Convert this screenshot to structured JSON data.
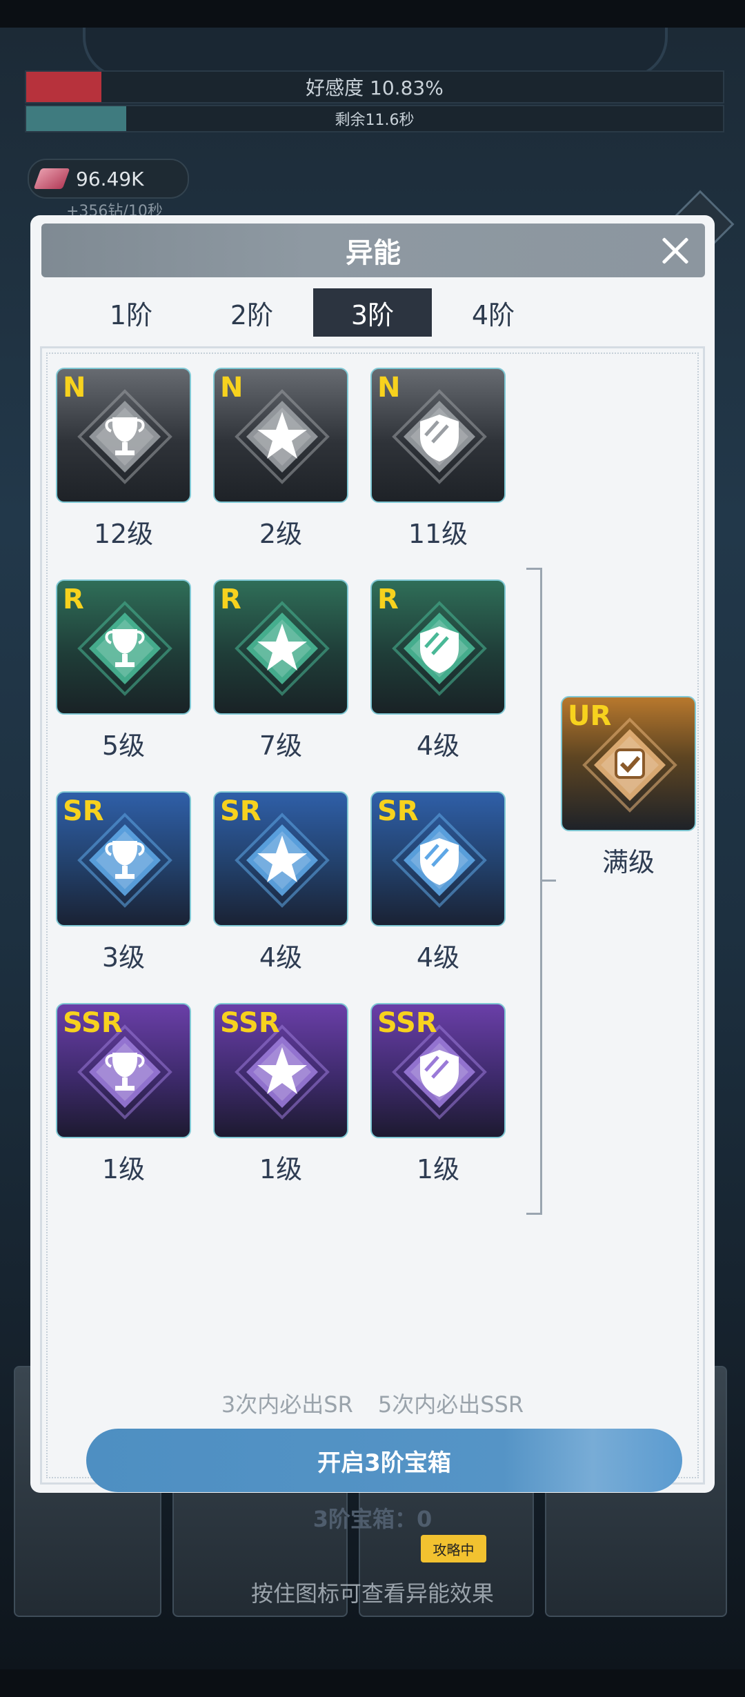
{
  "hud": {
    "affection": "好感度 10.83%",
    "affection_percent": 10.83,
    "remaining": "剩余11.6秒",
    "gems": "96.49K",
    "gem_rate": "+356钻/10秒",
    "bee_tag": "攻略中"
  },
  "modal": {
    "title": "异能",
    "tabs": [
      {
        "label": "1阶",
        "active": false
      },
      {
        "label": "2阶",
        "active": false
      },
      {
        "label": "3阶",
        "active": true
      },
      {
        "label": "4阶",
        "active": false
      }
    ],
    "grid": [
      {
        "rarity": "N",
        "icon": "trophy-icon",
        "level": "12级"
      },
      {
        "rarity": "N",
        "icon": "star-icon",
        "level": "2级"
      },
      {
        "rarity": "N",
        "icon": "shield-icon",
        "level": "11级"
      },
      {
        "rarity": "R",
        "icon": "trophy-icon",
        "level": "5级"
      },
      {
        "rarity": "R",
        "icon": "star-icon",
        "level": "7级"
      },
      {
        "rarity": "R",
        "icon": "shield-icon",
        "level": "4级"
      },
      {
        "rarity": "SR",
        "icon": "trophy-icon",
        "level": "3级"
      },
      {
        "rarity": "SR",
        "icon": "star-icon",
        "level": "4级"
      },
      {
        "rarity": "SR",
        "icon": "shield-icon",
        "level": "4级"
      },
      {
        "rarity": "SSR",
        "icon": "trophy-icon",
        "level": "1级"
      },
      {
        "rarity": "SSR",
        "icon": "star-icon",
        "level": "1级"
      },
      {
        "rarity": "SSR",
        "icon": "shield-icon",
        "level": "1级"
      }
    ],
    "ultimate": {
      "rarity": "UR",
      "icon": "check-icon",
      "level": "满级"
    },
    "guarantee_sr": "3次内必出SR",
    "guarantee_ssr": "5次内必出SSR",
    "open_button": "开启3阶宝箱",
    "box_count": "3阶宝箱：0",
    "hint": "按住图标可查看异能效果"
  },
  "colors": {
    "N": "#9a9ea3",
    "R": "#49b896",
    "SR": "#5ea7e6",
    "SSR": "#9a7ad8",
    "UR": "#e7b47a",
    "rarity_text": "#f7d21e"
  }
}
